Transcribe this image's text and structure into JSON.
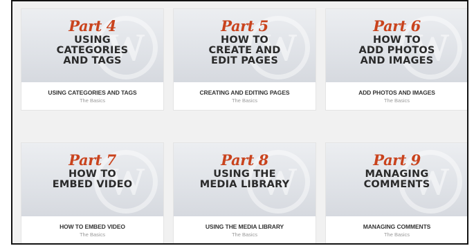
{
  "cards": [
    {
      "part": "Part 4",
      "headline": [
        "USING",
        "CATEGORIES",
        "AND TAGS"
      ],
      "title": "USING CATEGORIES AND TAGS",
      "subtitle": "The Basics"
    },
    {
      "part": "Part 5",
      "headline": [
        "HOW TO",
        "CREATE AND",
        "EDIT PAGES"
      ],
      "title": "CREATING AND EDITING PAGES",
      "subtitle": "The Basics"
    },
    {
      "part": "Part 6",
      "headline": [
        "HOW TO",
        "ADD PHOTOS",
        "AND IMAGES"
      ],
      "title": "ADD PHOTOS AND IMAGES",
      "subtitle": "The Basics"
    },
    {
      "part": "Part 7",
      "headline": [
        "HOW TO",
        "EMBED VIDEO",
        ""
      ],
      "title": "HOW TO EMBED VIDEO",
      "subtitle": "The Basics"
    },
    {
      "part": "Part 8",
      "headline": [
        "USING THE",
        "MEDIA LIBRARY",
        ""
      ],
      "title": "USING THE MEDIA LIBRARY",
      "subtitle": "The Basics"
    },
    {
      "part": "Part 9",
      "headline": [
        "MANAGING",
        "COMMENTS",
        ""
      ],
      "title": "MANAGING COMMENTS",
      "subtitle": "The Basics"
    }
  ],
  "watermark_icon": "wordpress-logo-icon",
  "colors": {
    "part_accent": "#c9431d",
    "headline": "#2a2a2a",
    "background": "#f1f1f1"
  }
}
